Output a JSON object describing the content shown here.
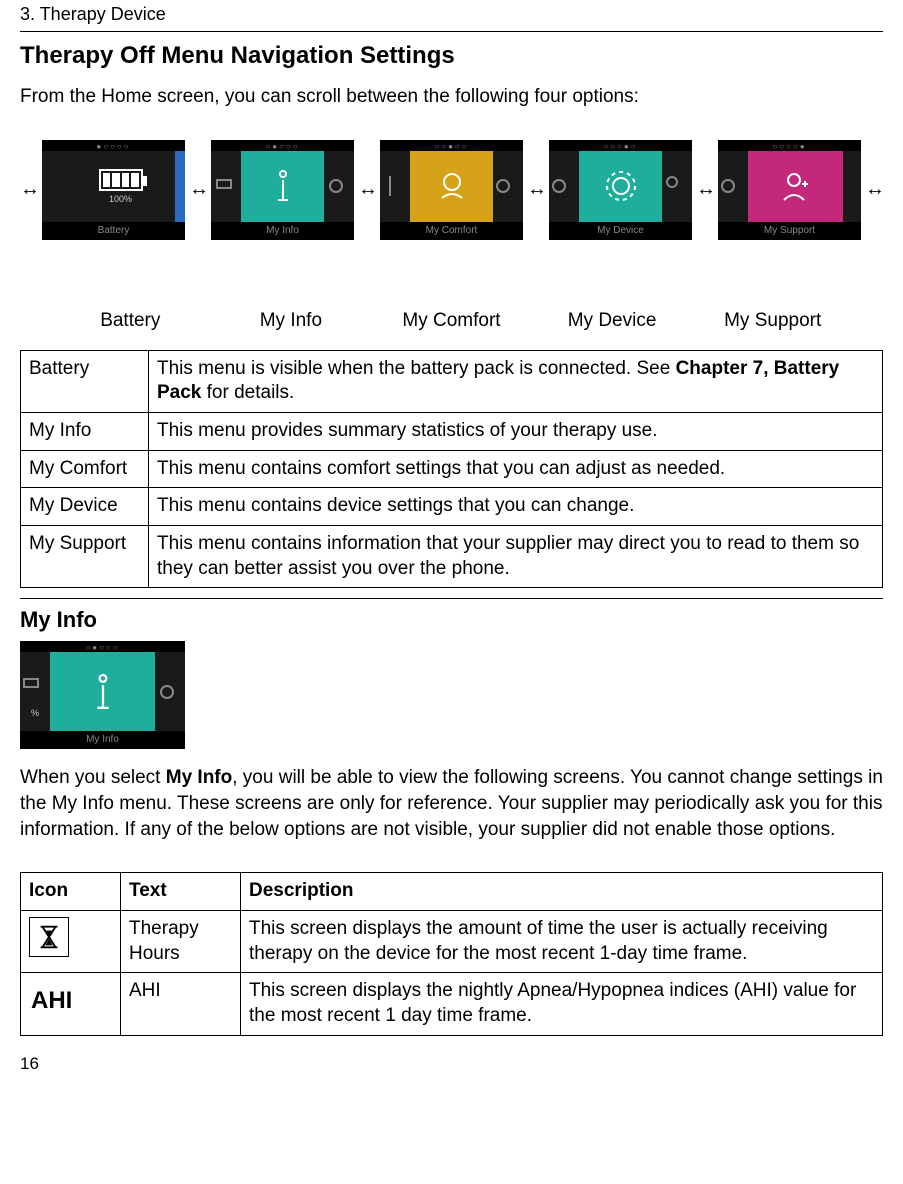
{
  "chapter_header": "3. Therapy Device",
  "section_title": "Therapy Off Menu Navigation Settings",
  "intro_text": "From the Home screen, you can scroll between the following four options:",
  "screens": {
    "battery_pct": "100%",
    "labels": {
      "battery": "Battery",
      "my_info": "My Info",
      "my_comfort": "My Comfort",
      "my_device": "My Device",
      "my_support": "My Support"
    }
  },
  "caption_labels": {
    "battery": "Battery",
    "my_info": "My Info",
    "my_comfort": "My Comfort",
    "my_device": "My Device",
    "my_support": "My Support"
  },
  "menu_table": {
    "rows": [
      {
        "name": "Battery",
        "desc_pre": "This menu is visible when the battery pack is connected. See ",
        "desc_bold": "Chapter 7, Battery Pack",
        "desc_post": " for details."
      },
      {
        "name": "My Info",
        "desc": "This menu provides summary statistics of your therapy use."
      },
      {
        "name": "My Comfort",
        "desc": "This menu contains comfort settings that you can adjust as needed."
      },
      {
        "name": "My Device",
        "desc": "This menu contains device settings that you can change."
      },
      {
        "name": "My Support",
        "desc": "This menu contains information that your supplier may direct you to read to them so they can better assist you over the phone."
      }
    ]
  },
  "my_info_heading": "My Info",
  "my_info_para_pre": "When you select ",
  "my_info_para_bold": "My Info",
  "my_info_para_post": ", you will be able to view the following screens. You cannot change settings in the My Info menu. These screens are only for reference. Your supplier may periodically ask you for this information. If any of the below options are not visible, your supplier did not enable those options.",
  "icons_table": {
    "headers": {
      "icon": "Icon",
      "text": "Text",
      "desc": "Description"
    },
    "rows": [
      {
        "icon_label": "hourglass",
        "text": "Therapy Hours",
        "desc": "This screen displays the amount of time the user is actually receiving therapy on the device for the most recent 1-day time frame."
      },
      {
        "icon_label": "AHI",
        "text": "AHI",
        "desc": "This screen displays the nightly Apnea/Hypopnea indices (AHI) value for the most recent 1 day time frame."
      }
    ]
  },
  "page_number": "16",
  "small_screen_pct": "%"
}
